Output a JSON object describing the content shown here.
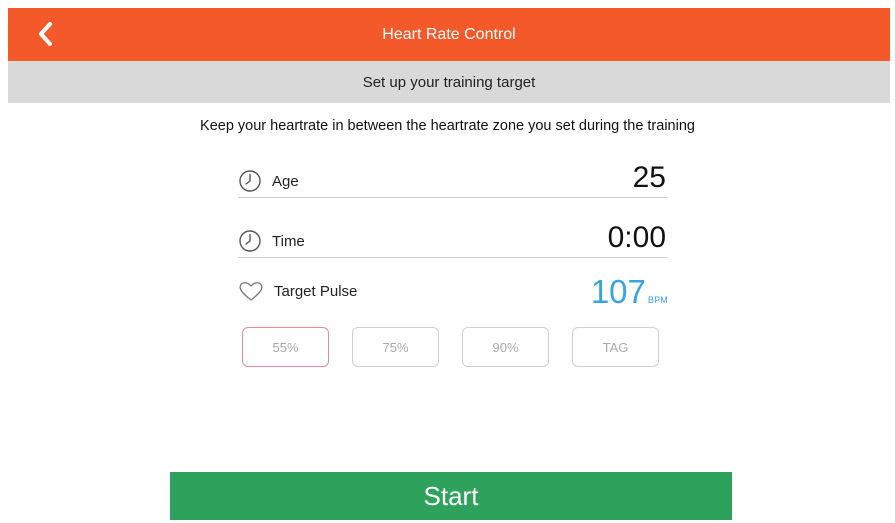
{
  "header": {
    "title": "Heart Rate Control",
    "back_icon": "chevron-left-icon",
    "background": "#f4592a"
  },
  "subheader": {
    "text": "Set up your training target"
  },
  "instructions": "Keep your heartrate in between the heartrate zone you set during the training",
  "fields": {
    "age": {
      "icon": "clock-icon",
      "label": "Age",
      "value": "25"
    },
    "time": {
      "icon": "clock-icon",
      "label": "Time",
      "value": "0:00"
    },
    "target_pulse": {
      "icon": "heart-icon",
      "label": "Target Pulse",
      "value": "107",
      "unit": "BPM",
      "value_color": "#3aa3de"
    }
  },
  "zones": [
    {
      "label": "55%",
      "selected": true
    },
    {
      "label": "75%",
      "selected": false
    },
    {
      "label": "90%",
      "selected": false
    },
    {
      "label": "TAG",
      "selected": false
    }
  ],
  "start_button": {
    "label": "Start",
    "background": "#2ea15c"
  }
}
